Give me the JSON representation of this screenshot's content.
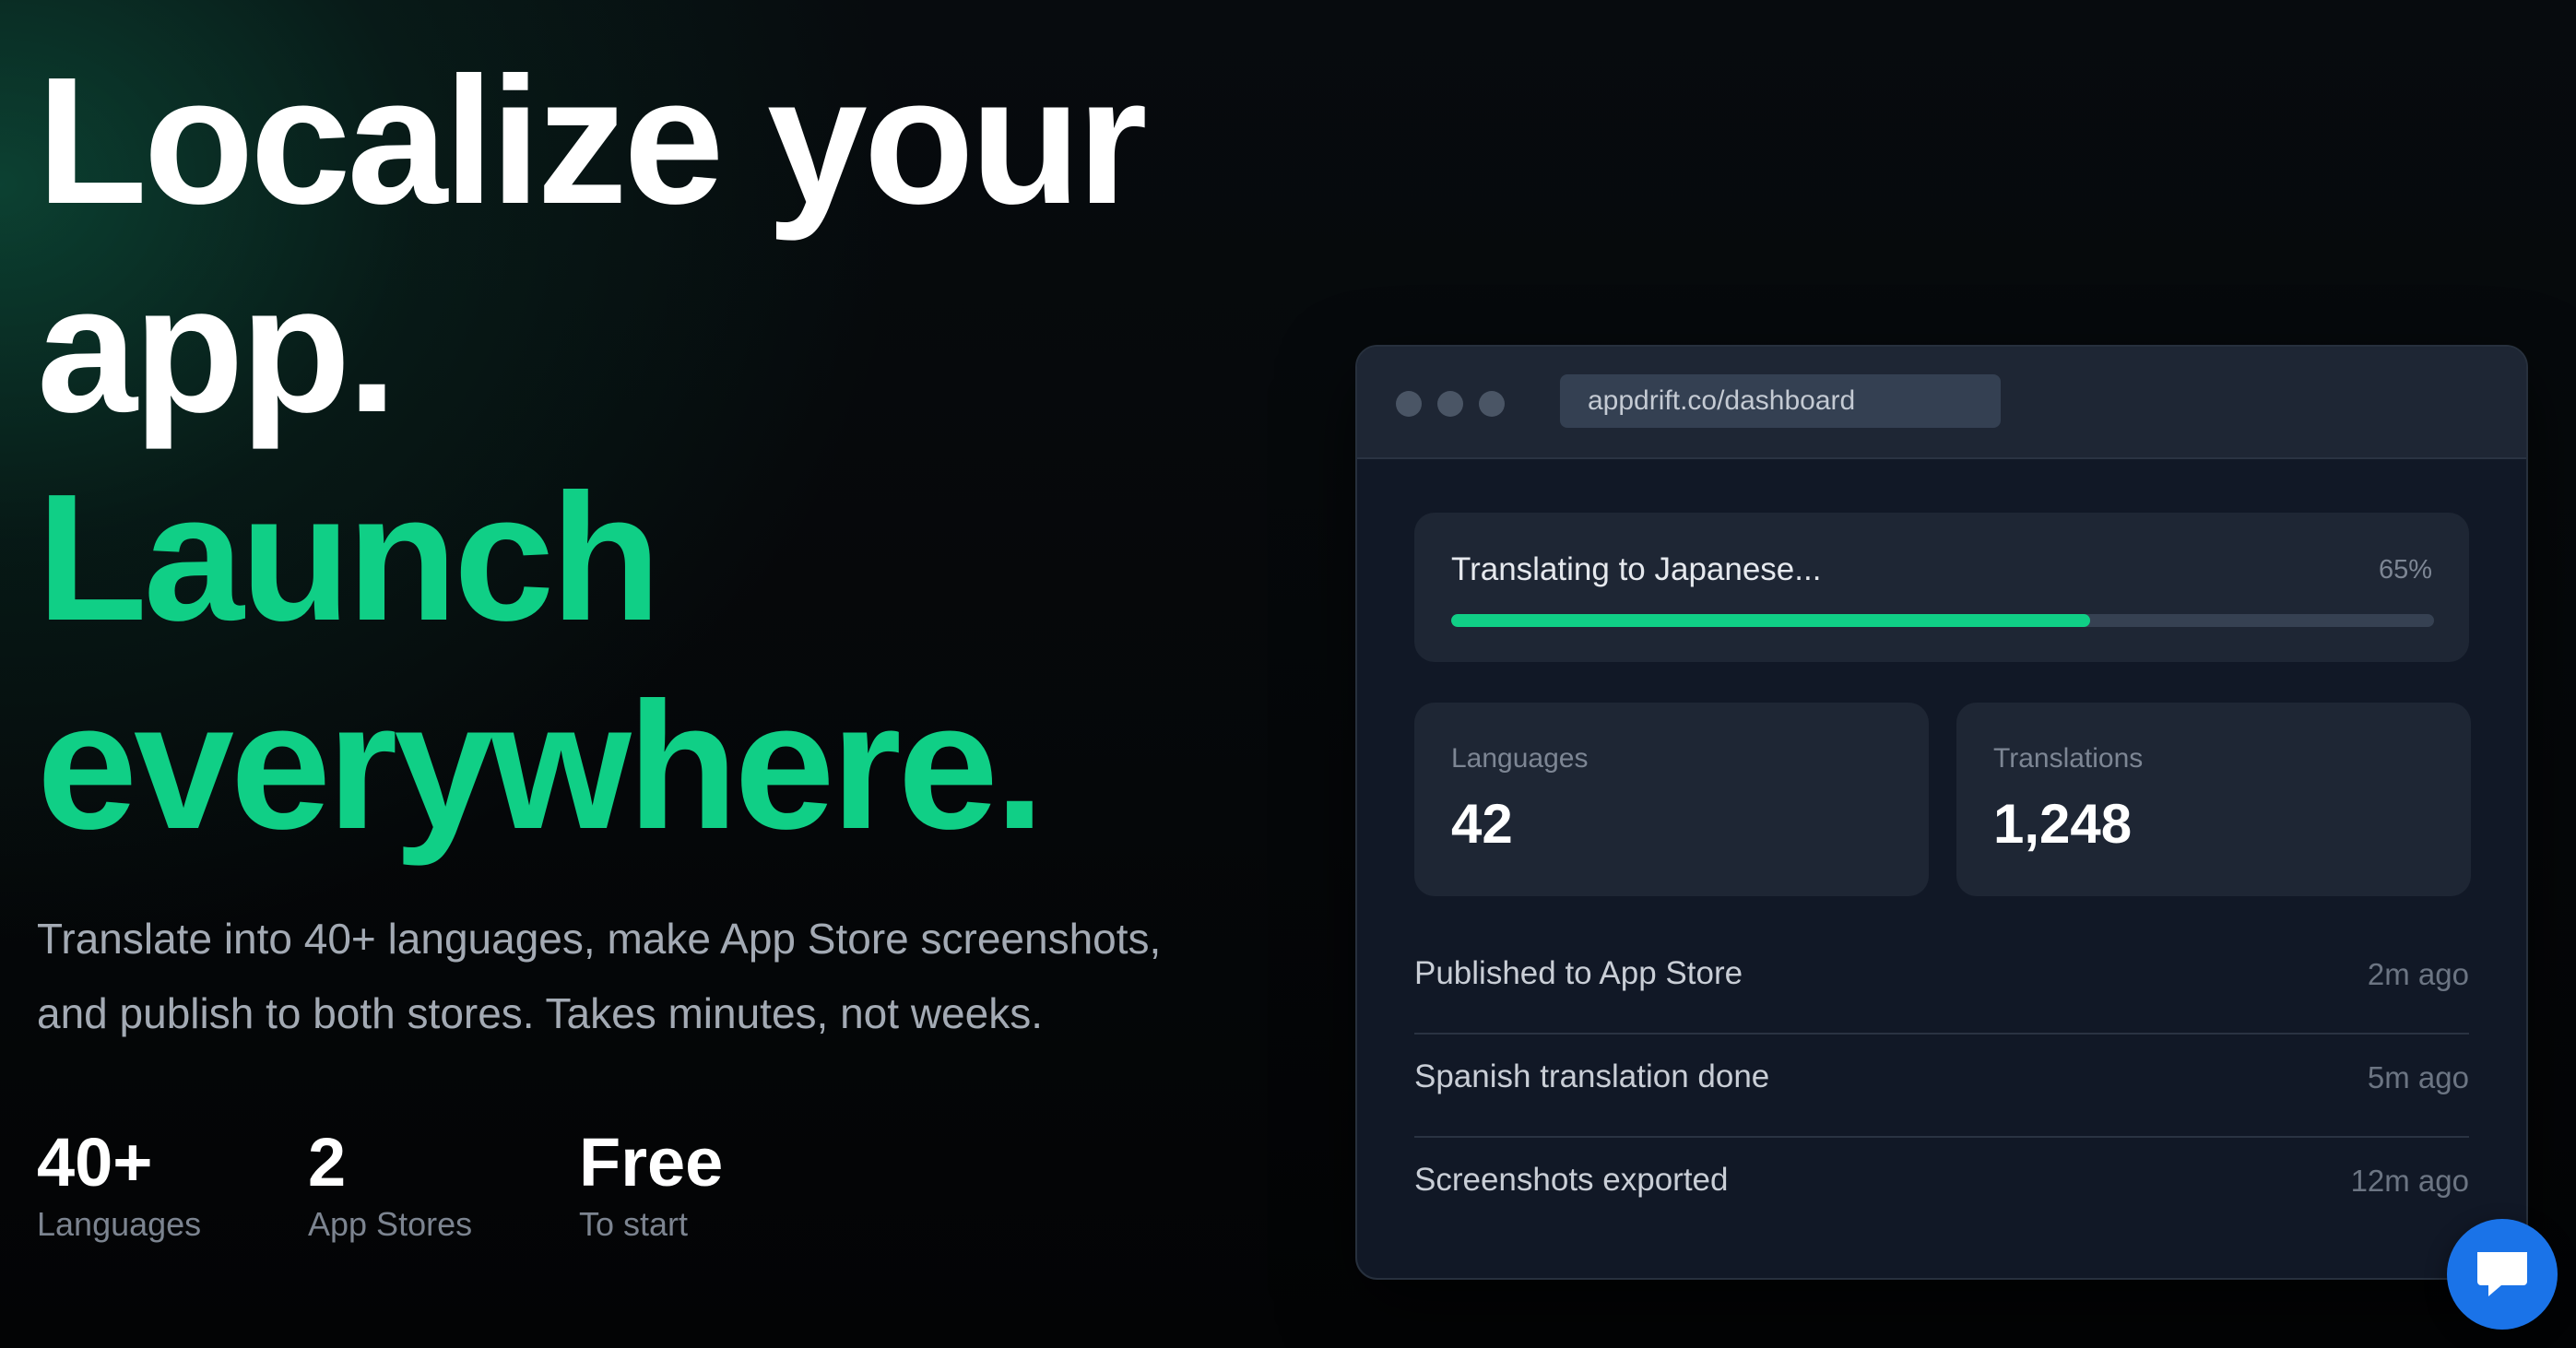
{
  "hero": {
    "headline_line1": "Localize your",
    "headline_line2": "app.",
    "headline_line3": "Launch",
    "headline_line4": "everywhere.",
    "subcopy_line1": "Translate into 40+ languages, make App Store screenshots,",
    "subcopy_line2": "and publish to both stores. Takes minutes, not weeks.",
    "accent_color": "#10cf86"
  },
  "stats": [
    {
      "value": "40+",
      "label": "Languages"
    },
    {
      "value": "2",
      "label": "App Stores"
    },
    {
      "value": "Free",
      "label": "To start"
    }
  ],
  "dashboard": {
    "url": "appdrift.co/dashboard",
    "progress": {
      "label": "Translating to Japanese...",
      "percent_text": "65%",
      "percent": 65
    },
    "metrics": [
      {
        "label": "Languages",
        "value": "42"
      },
      {
        "label": "Translations",
        "value": "1,248"
      }
    ],
    "activity": [
      {
        "text": "Published to App Store",
        "time": "2m ago"
      },
      {
        "text": "Spanish translation done",
        "time": "5m ago"
      },
      {
        "text": "Screenshots exported",
        "time": "12m ago"
      }
    ]
  },
  "chat": {
    "icon": "chat-bubble-icon",
    "color": "#1a73e8"
  }
}
